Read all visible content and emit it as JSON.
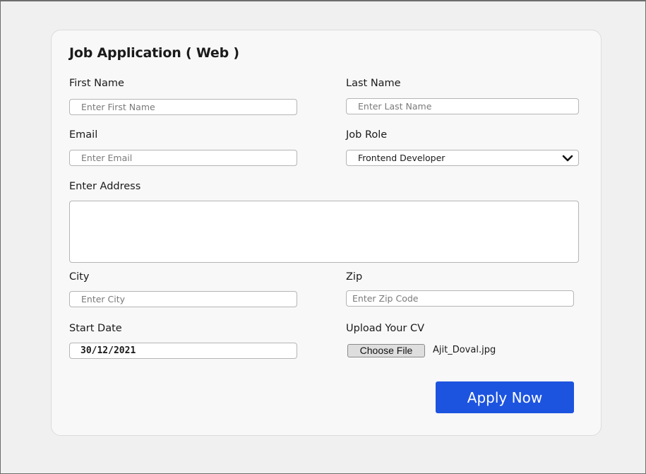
{
  "form": {
    "title": "Job Application ( Web )",
    "first_name": {
      "label": "First Name",
      "placeholder": "Enter First Name"
    },
    "last_name": {
      "label": "Last Name",
      "placeholder": "Enter Last Name"
    },
    "email": {
      "label": "Email",
      "placeholder": "Enter Email"
    },
    "job_role": {
      "label": "Job Role",
      "selected": "Frontend Developer"
    },
    "address": {
      "label": "Enter Address",
      "value": ""
    },
    "city": {
      "label": "City",
      "placeholder": "Enter City"
    },
    "zip": {
      "label": "Zip",
      "placeholder": "Enter Zip Code"
    },
    "start_date": {
      "label": "Start Date",
      "value": "30/12/2021"
    },
    "cv": {
      "label": "Upload Your CV",
      "button": "Choose File",
      "file_name": "Ajit_Doval.jpg"
    },
    "submit_label": "Apply Now"
  },
  "colors": {
    "accent": "#1c54e0",
    "page_bg": "#f0f0f0",
    "card_bg": "#f8f8f8"
  },
  "icons": {
    "job_role_dropdown": "chevron-down-icon"
  }
}
